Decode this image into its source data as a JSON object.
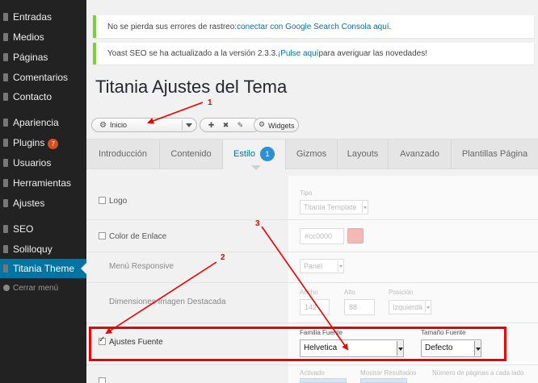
{
  "sidebar": {
    "items": [
      {
        "label": "Entradas"
      },
      {
        "label": "Medios"
      },
      {
        "label": "Páginas"
      },
      {
        "label": "Comentarios"
      },
      {
        "label": "Contacto"
      },
      {
        "label": "Apariencia"
      },
      {
        "label": "Plugins",
        "badge": "7"
      },
      {
        "label": "Usuarios"
      },
      {
        "label": "Herramientas"
      },
      {
        "label": "Ajustes"
      },
      {
        "label": "SEO"
      },
      {
        "label": "Soliloquy"
      },
      {
        "label": "Titania Theme"
      }
    ],
    "collapse_label": "Cerrar menú"
  },
  "notices": {
    "gsc_text": "No se pierda sus errores de rastreo: ",
    "gsc_link": "conectar con Google Search Consola aquí",
    "gsc_end": ".",
    "yoast_text": "Yoast SEO se ha actualizado a la versión 2.3.3. ",
    "yoast_link": "¡Pulse aquí",
    "yoast_end": " para averiguar las novedades!"
  },
  "page_title": "Titania Ajustes del Tema",
  "toolbar": {
    "preset_value": "Inicio",
    "widgets_label": "Widgets"
  },
  "tabs": [
    {
      "label": "Introducción"
    },
    {
      "label": "Contenido"
    },
    {
      "label": "Estilo",
      "badge": "1"
    },
    {
      "label": "Gizmos"
    },
    {
      "label": "Layouts"
    },
    {
      "label": "Avanzado"
    },
    {
      "label": "Plantillas Página"
    }
  ],
  "rows": {
    "logo": {
      "label": "Logo",
      "type_label": "Tipo",
      "type_value": "Titania Template"
    },
    "link_color": {
      "label": "Color de Enlace",
      "value": "#cc0000",
      "swatch_color": "#f4b9b4"
    },
    "responsive_menu": {
      "label": "Menú Responsive",
      "value": "Panel"
    },
    "featured_image": {
      "label": "Dimensiones Imagen Destacada",
      "width_label": "Ancho",
      "width_value": "142",
      "height_label": "Alto",
      "height_value": "88",
      "position_label": "Posición",
      "position_value": "Izquierda"
    },
    "font_settings": {
      "label": "Ajustes Fuente",
      "family_label": "Familia Fuente",
      "family_value": "Helvetica",
      "size_label": "Tamaño Fuente",
      "size_value": "Defecto"
    },
    "next_row": {
      "enabled_label": "Activado",
      "results_label": "Mostrar Resultados",
      "pages_label": "Número de páginas a cada lado"
    }
  },
  "annotations": [
    {
      "number": "1"
    },
    {
      "number": "2"
    },
    {
      "number": "3"
    }
  ],
  "colors": {
    "sidebar_bg": "#222222",
    "active_menu": "#0074a2",
    "notice_border": "#7ad03a",
    "annotation": "#ee0000"
  }
}
